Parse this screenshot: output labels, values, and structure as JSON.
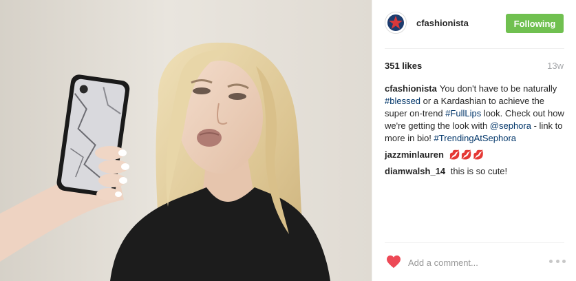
{
  "post": {
    "photo": {
      "icon": "selfie-photo",
      "description_colors": {
        "wall": "#e4dfd7",
        "hair": "#e2cfa0",
        "top": "#1a1a1a",
        "phone_case": "#d9d9dd"
      }
    },
    "header": {
      "username": "cfashionista",
      "follow_label": "Following",
      "follow_color": "#70c050",
      "avatar_icon": "star-icon"
    },
    "meta": {
      "likes": "351 likes",
      "time": "13w"
    },
    "caption": {
      "user": "cfashionista",
      "parts": {
        "t1": "You don't have to be naturally ",
        "h1": "#blessed",
        "t2": " or a Kardashian to achieve the super on-trend ",
        "h2": "#FullLips",
        "t3": " look. Check out how we're getting the look with ",
        "m1": "@sephora",
        "t4": " - link to more in bio! ",
        "h3": "#TrendingAtSephora"
      }
    },
    "comments": [
      {
        "user": "jazzminlauren",
        "text": "💋💋💋"
      },
      {
        "user": "diamwalsh_14",
        "text": "this is so cute!"
      }
    ],
    "footer": {
      "like_icon": "heart-icon",
      "like_color": "#ed4956",
      "comment_placeholder": "Add a comment...",
      "more_icon": "more-options-icon"
    }
  }
}
